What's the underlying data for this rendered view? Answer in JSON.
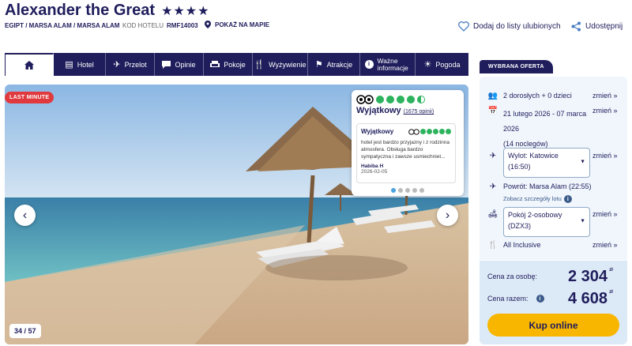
{
  "header": {
    "title": "Alexander the Great",
    "stars": "★★★★",
    "breadcrumb": "EGIPT / MARSA ALAM / MARSA ALAM",
    "code_label": "KOD HOTELU",
    "code_value": "RMF14003",
    "map_label": "POKAŻ NA MAPIE",
    "favorite_label": "Dodaj do listy ulubionych",
    "share_label": "Udostępnij"
  },
  "tabs": [
    {
      "label": "",
      "icon": "home-icon"
    },
    {
      "label": "Hotel",
      "icon": "bed-icon"
    },
    {
      "label": "Przelot",
      "icon": "plane-icon"
    },
    {
      "label": "Opinie",
      "icon": "chat-icon"
    },
    {
      "label": "Pokoje",
      "icon": "sofa-icon"
    },
    {
      "label": "Wyżywienie",
      "icon": "cutlery-icon"
    },
    {
      "label": "Atrakcje",
      "icon": "flag-icon"
    },
    {
      "label": "Ważne informacje",
      "icon": "info-icon"
    },
    {
      "label": "Pogoda",
      "icon": "sun-icon"
    }
  ],
  "gallery": {
    "badge": "LAST MINUTE",
    "counter": "34 / 57"
  },
  "tripadvisor": {
    "rating_label": "Wyjątkowy",
    "reviews_count": "(1675 opinii)",
    "review": {
      "title": "Wyjątkowy",
      "text": "hotel jest bardzo przyjazny i z rodzinna atmosfera. Obsługa bardzo sympatyczna i zawsze usmiechniet...",
      "author": "Habiba H",
      "date": "2026-02-05"
    }
  },
  "offer": {
    "tab_label": "WYBRANA OFERTA",
    "change_label": "zmień »",
    "people": "2 dorosłych + 0 dzieci",
    "dates_line1": "21 lutego 2026 - 07 marca",
    "dates_line2": "2026",
    "nights": "(14 noclegów)",
    "departure_line1": "Wylot: Katowice",
    "departure_line2": "(16:50)",
    "return_flight": "Powrót: Marsa Alam (22:55)",
    "flight_details": "Zobacz szczegóły lotu",
    "room_line1": "Pokój 2-osobowy",
    "room_line2": "(DZX3)",
    "board": "All Inclusive"
  },
  "price": {
    "per_person_label": "Cena za osobę:",
    "per_person_value": "2 304",
    "total_label": "Cena razem:",
    "total_value": "4 608",
    "currency": "zł",
    "buy_label": "Kup online"
  },
  "colors": {
    "navy": "#1f1d5c",
    "accent_yellow": "#f8b600",
    "badge_red": "#e03a3e",
    "tripadvisor_green": "#2db35d"
  }
}
